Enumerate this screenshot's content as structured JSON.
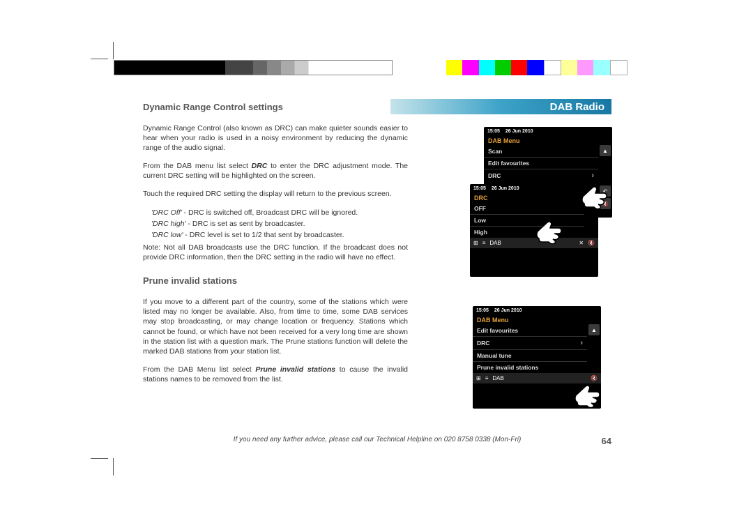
{
  "header": {
    "title": "DAB Radio"
  },
  "section1": {
    "title": "Dynamic Range Control settings",
    "p1": "Dynamic Range Control (also known as DRC) can make quieter sounds easier to hear when your radio is used in a noisy environment by reducing the dynamic range of the audio signal.",
    "p2a": "From the DAB menu list select ",
    "p2b": "DRC",
    "p2c": " to enter the DRC adjustment mode. The current DRC setting will be highlighted on the screen.",
    "p3": "Touch the required DRC setting the display will return to the previous screen.",
    "li1a": "'DRC Off'",
    "li1b": " - DRC is switched off, Broadcast DRC will be ignored.",
    "li2a": "'DRC high'",
    "li2b": " - DRC is set as sent by broadcaster.",
    "li3a": "'DRC low'",
    "li3b": " - DRC level is set to 1/2 that sent by broadcaster.",
    "p4": "Note: Not all DAB broadcasts use the DRC function. If the broadcast does not provide DRC information, then the DRC setting in the radio will have no effect."
  },
  "section2": {
    "title": "Prune invalid stations",
    "p1": "If you move to a different part of the country, some of the stations which were listed may no longer be available. Also, from time to time, some DAB services may stop broadcasting, or may change location or frequency. Stations which cannot be found, or which have not been received for a very long time are shown in the station list with a question mark. The Prune stations function will delete the marked DAB stations from your station list.",
    "p2a": "From the DAB Menu list select ",
    "p2b": "Prune invalid stations",
    "p2c": " to cause the invalid stations names to be removed from the list."
  },
  "screens": {
    "time": "15:05",
    "date": "26 Jun 2010",
    "menu_title": "DAB Menu",
    "drc_title": "DRC",
    "footer_mode": "DAB",
    "s1": {
      "items": [
        "Scan",
        "Edit favourites",
        "DRC"
      ]
    },
    "s2": {
      "items": [
        "OFF",
        "Low",
        "High"
      ]
    },
    "s3": {
      "items": [
        "Edit favourites",
        "DRC",
        "Manual tune",
        "Prune invalid stations"
      ]
    }
  },
  "footer": {
    "helpline": "If you need any further advice, please call our Technical Helpline on 020 8758 0338 (Mon-Fri)",
    "page": "64"
  }
}
